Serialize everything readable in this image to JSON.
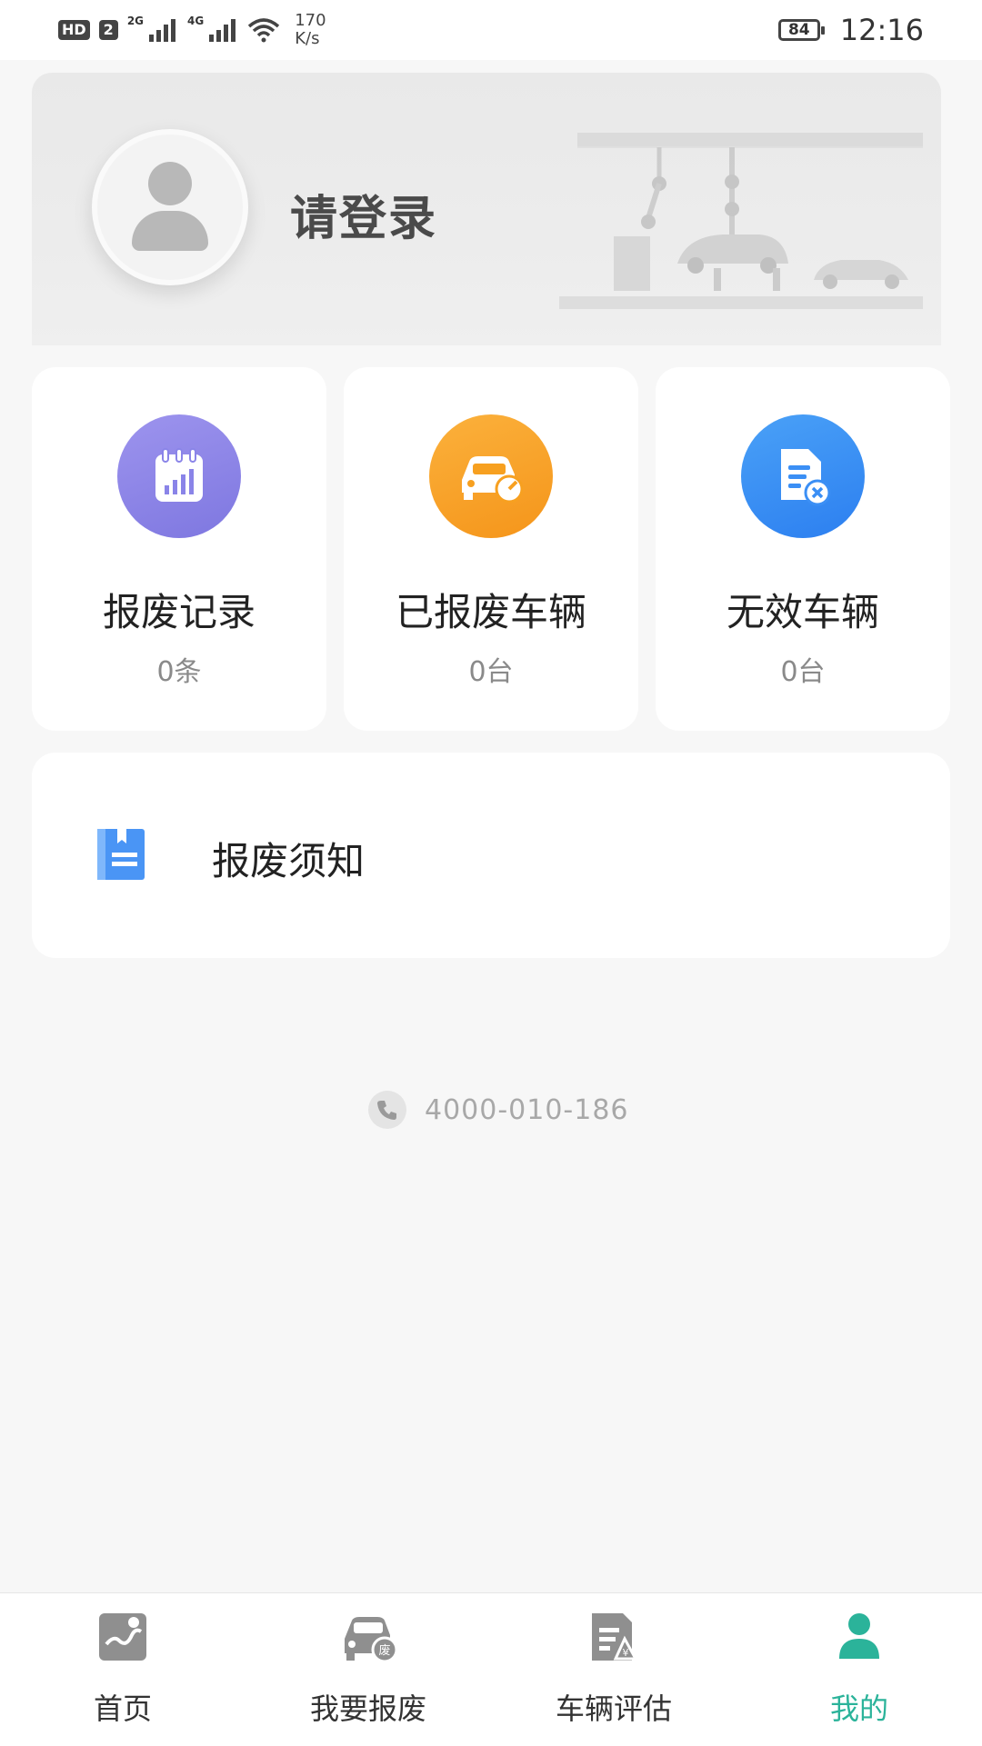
{
  "status_bar": {
    "hd_label": "HD",
    "sim_label": "2",
    "net1": "2G",
    "net2": "4G",
    "speed_value": "170",
    "speed_unit": "K/s",
    "battery": "84",
    "time": "12:16"
  },
  "header": {
    "login_text": "请登录"
  },
  "stats": [
    {
      "label": "报废记录",
      "count": "0条",
      "icon": "calendar-chart-icon",
      "color": "#8a84e8"
    },
    {
      "label": "已报废车辆",
      "count": "0台",
      "icon": "car-gauge-icon",
      "color": "#f7a020"
    },
    {
      "label": "无效车辆",
      "count": "0台",
      "icon": "doc-cancel-icon",
      "color": "#3b8ff5"
    }
  ],
  "notice": {
    "label": "报废须知",
    "icon": "notebook-icon"
  },
  "contact": {
    "phone": "4000-010-186",
    "icon": "phone-icon"
  },
  "bottom_nav": {
    "items": [
      {
        "label": "首页",
        "icon": "map-icon",
        "active": false
      },
      {
        "label": "我要报废",
        "icon": "scrap-car-icon",
        "active": false
      },
      {
        "label": "车辆评估",
        "icon": "evaluate-icon",
        "active": false
      },
      {
        "label": "我的",
        "icon": "user-icon",
        "active": true
      }
    ],
    "active_color": "#2bb39a"
  }
}
